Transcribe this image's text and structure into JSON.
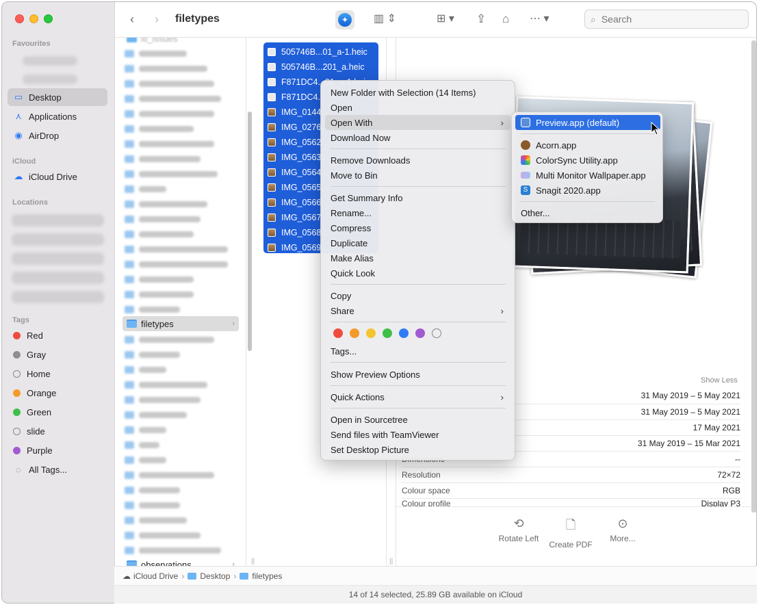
{
  "window": {
    "title": "filetypes"
  },
  "toolbar": {
    "search_placeholder": "Search"
  },
  "sidebar": {
    "favourites_label": "Favourites",
    "favourites": [
      {
        "label": "Desktop",
        "icon": "desktop-icon",
        "selected": true
      },
      {
        "label": "Applications",
        "icon": "applications-icon"
      },
      {
        "label": "AirDrop",
        "icon": "airdrop-icon"
      }
    ],
    "icloud_label": "iCloud",
    "icloud": [
      {
        "label": "iCloud Drive",
        "icon": "cloud-icon"
      }
    ],
    "locations_label": "Locations",
    "tags_label": "Tags",
    "tags": [
      {
        "label": "Red",
        "color": "#f04b3e"
      },
      {
        "label": "Gray",
        "color": "#8e8e90"
      },
      {
        "label": "Home",
        "color": ""
      },
      {
        "label": "Orange",
        "color": "#f49a2a"
      },
      {
        "label": "Green",
        "color": "#3fbf4a"
      },
      {
        "label": "slide",
        "color": ""
      },
      {
        "label": "Purple",
        "color": "#a05bd0"
      },
      {
        "label": "All Tags...",
        "color": "all"
      }
    ]
  },
  "column1": {
    "top_item": "iti_issues",
    "selected_folder": "filetypes",
    "bottom_item": "observations"
  },
  "column2": {
    "files": [
      "505746B...01_a-1.heic",
      "505746B...201_a.heic",
      "F871DC4...01_a-1.heic",
      "F871DC4...",
      "IMG_0144...",
      "IMG_0276...",
      "IMG_0562...",
      "IMG_0563...",
      "IMG_0564...",
      "IMG_0565...",
      "IMG_0566...",
      "IMG_0567...",
      "IMG_0568...",
      "IMG_0569..."
    ]
  },
  "preview": {
    "show_less": "Show Less",
    "info": [
      {
        "label": "",
        "value": "31 May 2019 – 5 May 2021"
      },
      {
        "label": "",
        "value": "31 May 2019 – 5 May 2021"
      },
      {
        "label": "",
        "value": "17 May 2021"
      },
      {
        "label": "",
        "value": "31 May 2019 – 15 Mar 2021"
      },
      {
        "label": "Dimensions",
        "value": "--"
      },
      {
        "label": "Resolution",
        "value": "72×72"
      },
      {
        "label": "Colour space",
        "value": "RGB"
      },
      {
        "label": "Colour profile",
        "value": "Display P3"
      }
    ],
    "actions": [
      {
        "label": "Rotate Left",
        "icon": "rotate-left-icon"
      },
      {
        "label": "Create PDF",
        "icon": "create-pdf-icon"
      },
      {
        "label": "More...",
        "icon": "more-icon"
      }
    ]
  },
  "context_menu": {
    "items": {
      "new_folder": "New Folder with Selection (14 Items)",
      "open": "Open",
      "open_with": "Open With",
      "download_now": "Download Now",
      "remove_downloads": "Remove Downloads",
      "move_to_bin": "Move to Bin",
      "get_summary_info": "Get Summary Info",
      "rename": "Rename...",
      "compress": "Compress",
      "duplicate": "Duplicate",
      "make_alias": "Make Alias",
      "quick_look": "Quick Look",
      "copy": "Copy",
      "share": "Share",
      "tags": "Tags...",
      "show_preview_options": "Show Preview Options",
      "quick_actions": "Quick Actions",
      "open_in_sourcetree": "Open in Sourcetree",
      "send_files_teamviewer": "Send files with TeamViewer",
      "set_desktop_picture": "Set Desktop Picture"
    },
    "tag_colors": [
      "#f04b3e",
      "#f49a2a",
      "#f4c430",
      "#3fbf4a",
      "#2f7cf6",
      "#a05bd0",
      "none"
    ]
  },
  "open_with_submenu": {
    "default_app": "Preview.app (default)",
    "apps": [
      "Acorn.app",
      "ColorSync Utility.app",
      "Multi Monitor Wallpaper.app",
      "Snagit 2020.app"
    ],
    "other": "Other..."
  },
  "pathbar": {
    "segments": [
      "iCloud Drive",
      "Desktop",
      "filetypes"
    ]
  },
  "statusbar": {
    "text": "14 of 14 selected, 25.89 GB available on iCloud"
  }
}
